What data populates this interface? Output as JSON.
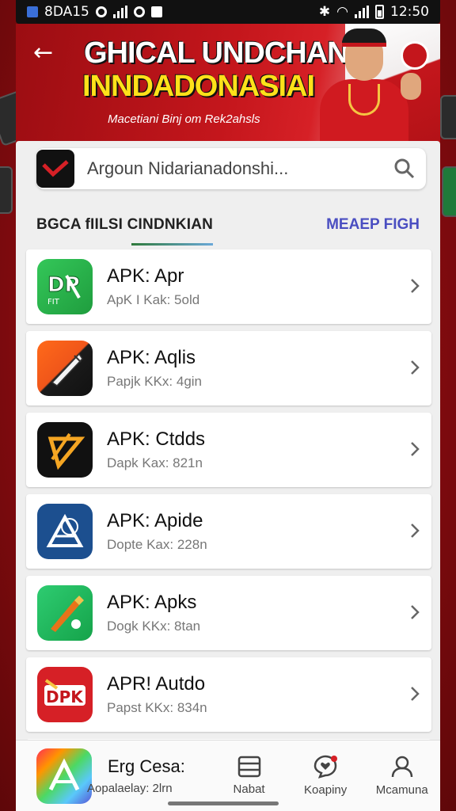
{
  "status_bar": {
    "left_text": "8DA15",
    "time": "12:50"
  },
  "banner": {
    "title_line1": "GHICAL UNDCHAN",
    "title_line2": "INNDADONASIAI",
    "subtitle": "Macetiani Binj om Rek2ahsls",
    "colors": {
      "red": "#c4161c",
      "yellow": "#ffe11a"
    }
  },
  "search": {
    "value": "Argoun Nidarianadonshi..."
  },
  "tabs": {
    "left_label": "BGCA fIILSI CINDNKIAN",
    "right_label": "MEAEP FIGH"
  },
  "apps": [
    {
      "title": "APK: Apr",
      "sub": "ApK I Kak: 5old",
      "icon": "dp-app-icon"
    },
    {
      "title": "APK: Aqlis",
      "sub": "Papjk KKx: 4gin",
      "icon": "pen-app-icon"
    },
    {
      "title": "APK: Ctdds",
      "sub": "Dapk Kax: 821n",
      "icon": "triangle-app-icon"
    },
    {
      "title": "APK: Apide",
      "sub": "Dopte Kax: 228n",
      "icon": "globe-app-icon"
    },
    {
      "title": "APK: Apks",
      "sub": "Dogk KKx: 8tan",
      "icon": "brush-app-icon"
    },
    {
      "title": "APR! Autdo",
      "sub": "Papst KKx: 834n",
      "icon": "dpk-app-icon"
    }
  ],
  "bottom_nav": {
    "app_title": "Erg Cesa:",
    "app_sub": "Aopalaelay: 2lrn",
    "items": [
      {
        "label": "Nabat",
        "icon": "list-icon"
      },
      {
        "label": "Koapiny",
        "icon": "chat-heart-icon"
      },
      {
        "label": "Mcamuna",
        "icon": "profile-icon"
      }
    ]
  }
}
